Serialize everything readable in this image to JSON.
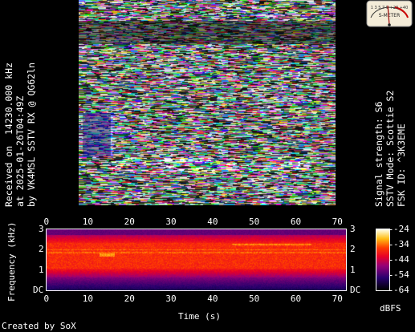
{
  "left_caption": {
    "line1": "Received on  14230.000 kHz",
    "line2": "at 2025-01-26T04:49Z",
    "line3": "by VK4MSL SSTV RX @ QG62ln"
  },
  "right_caption": {
    "line1": "Signal strength: S6",
    "line2": "SSTV Mode: Scottie S2",
    "line3": "FSK ID: ^3K3EME"
  },
  "s_meter": {
    "scale_text": "1 3 5 7 9 +20 +40",
    "label": "S-METER",
    "reading": "S6"
  },
  "spectrogram": {
    "ylabel": "Frequency (kHz)",
    "xlabel": "Time (s)",
    "y_ticks": [
      "3",
      "2",
      "1",
      "DC"
    ],
    "x_ticks": [
      "0",
      "10",
      "20",
      "30",
      "40",
      "50",
      "60",
      "70"
    ],
    "colorbar_unit": "dBFS",
    "colorbar_ticks": [
      "-24",
      "-34",
      "-44",
      "-54",
      "-64"
    ],
    "time_range_s": [
      0,
      72
    ],
    "freq_range_khz": [
      0,
      3
    ],
    "dbfs_range": [
      -64,
      -24
    ]
  },
  "footer": "Created by SoX",
  "colors": {
    "background": "#000000",
    "text": "#ffffff"
  }
}
